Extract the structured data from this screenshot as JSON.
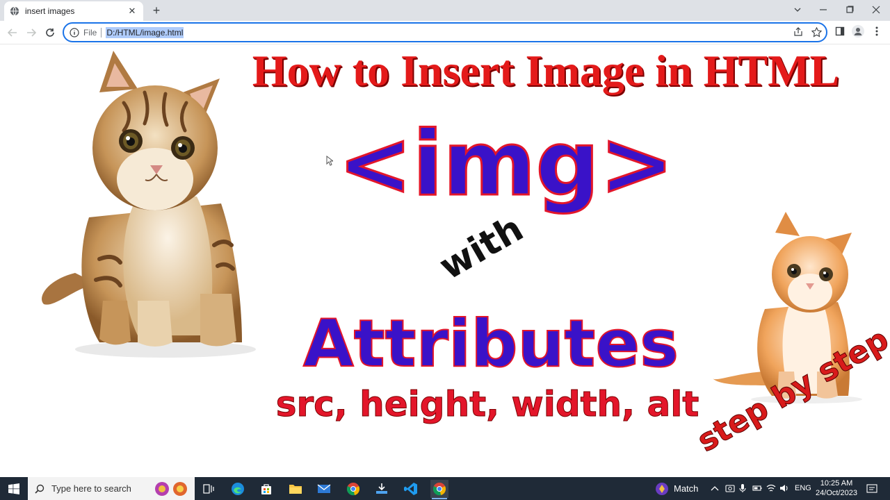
{
  "browser": {
    "tab_title": "insert images",
    "address_prefix": "File",
    "url": "D:/HTML/image.html"
  },
  "page": {
    "headline": "How to Insert Image in HTML",
    "tag": "<img>",
    "connector": "with",
    "subtitle": "Attributes",
    "attributes_list": "src, height, width, alt",
    "corner_note": "step by step"
  },
  "taskbar": {
    "search_placeholder": "Type here to search",
    "weather_label": "Match",
    "language": "ENG",
    "time": "10:25 AM",
    "date": "24/Oct/2023"
  },
  "colors": {
    "headline_red": "#e41a1a",
    "tag_blue": "#3a12c8",
    "outline_red": "#e3162a",
    "chrome_blue": "#1a73e8",
    "taskbar_bg": "#1f2a37"
  },
  "icons": [
    "globe-icon",
    "close-icon",
    "plus-icon",
    "chevron-down-icon",
    "minimize-icon",
    "maximize-icon",
    "window-close-icon",
    "back-icon",
    "forward-icon",
    "reload-icon",
    "info-icon",
    "share-icon",
    "star-icon",
    "sidepanel-icon",
    "profile-icon",
    "menu-icon",
    "windows-logo-icon",
    "search-icon",
    "task-view-icon",
    "edge-icon",
    "store-icon",
    "folder-icon",
    "mail-icon",
    "chrome-icon",
    "installer-icon",
    "vscode-icon",
    "notification-icon"
  ]
}
